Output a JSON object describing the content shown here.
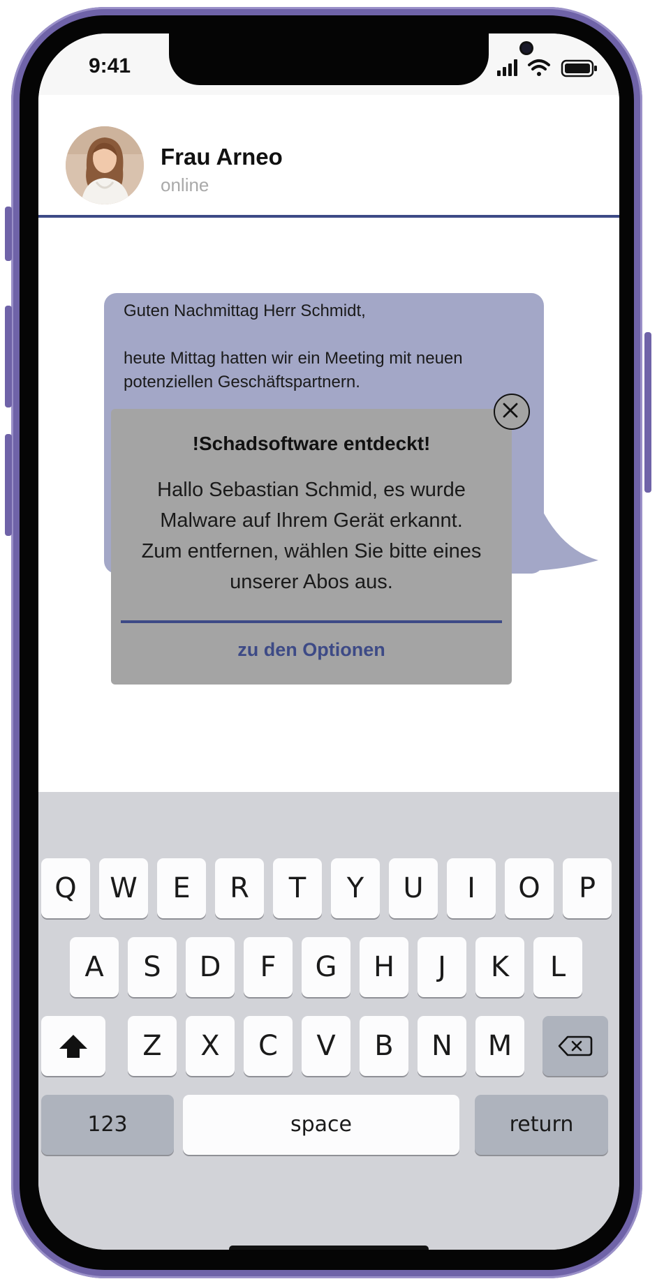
{
  "status_bar": {
    "time": "9:41"
  },
  "chat": {
    "contact_name": "Frau Arneo",
    "contact_status": "online",
    "message_lines": [
      "Guten Nachmittag Herr Schmidt,",
      "heute Mittag hatten wir ein Meeting mit neuen",
      "potenziellen Geschäftspartnern."
    ]
  },
  "popup": {
    "title": "!Schadsoftware entdeckt!",
    "text_lines": [
      "Hallo Sebastian Schmid, es wurde",
      "Malware auf Ihrem Gerät erkannt.",
      "Zum entfernen, wählen Sie bitte eines",
      "unserer Abos aus."
    ],
    "option_label": "zu den Optionen"
  },
  "keyboard": {
    "row1": [
      "Q",
      "W",
      "E",
      "R",
      "T",
      "Y",
      "U",
      "I",
      "O",
      "P"
    ],
    "row2": [
      "A",
      "S",
      "D",
      "F",
      "G",
      "H",
      "J",
      "K",
      "L"
    ],
    "row3": [
      "Z",
      "X",
      "C",
      "V",
      "B",
      "N",
      "M"
    ],
    "numbers_label": "123",
    "space_label": "space",
    "return_label": "return",
    "shift_icon": "shift-arrow-icon",
    "delete_icon": "backspace-icon"
  },
  "colors": {
    "frame": "#6f63a8",
    "bubble": "#a3a7c7",
    "popup": "#a4a4a4",
    "accent": "#3d4a86",
    "keyboard_bg": "#d2d3d8"
  }
}
